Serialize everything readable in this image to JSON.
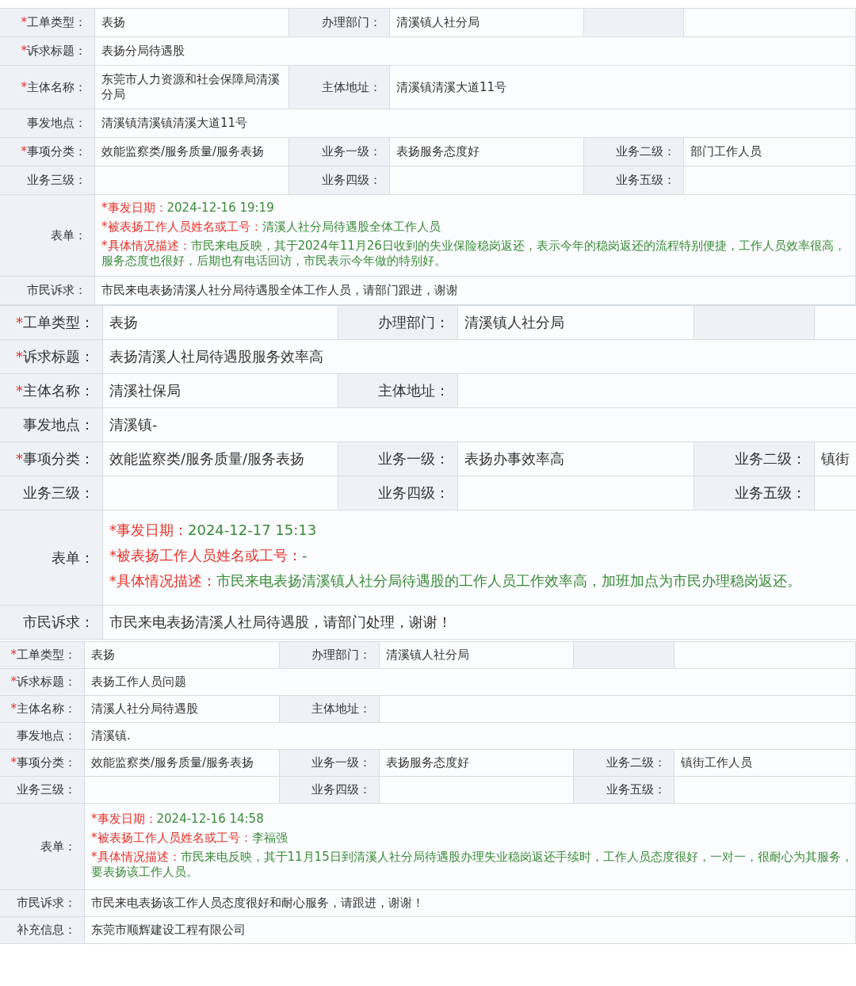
{
  "forms": [
    {
      "rows": [
        {
          "kind": "grid",
          "fields": [
            {
              "mark": "*",
              "label": "工单类型：",
              "value": "表扬"
            },
            {
              "label": "办理部门：",
              "value": "清溪镇人社分局"
            }
          ]
        },
        {
          "kind": "span",
          "fields": [
            {
              "mark": "*",
              "label": "诉求标题：",
              "value": "表扬分局待遇股"
            }
          ]
        },
        {
          "kind": "span",
          "fields": [
            {
              "mark": "*",
              "label": "主体名称：",
              "value": "东莞市人力资源和社会保障局清溪分局"
            },
            {
              "label": "主体地址：",
              "value": "清溪镇清溪大道11号"
            }
          ]
        },
        {
          "kind": "span",
          "fields": [
            {
              "label": "事发地点：",
              "value": "清溪镇清溪镇清溪大道11号"
            }
          ]
        },
        {
          "kind": "grid",
          "fields": [
            {
              "mark": "*",
              "label": "事项分类：",
              "value": "效能监察类/服务质量/服务表扬"
            },
            {
              "label": "业务一级：",
              "value": "表扬服务态度好"
            },
            {
              "label": "业务二级：",
              "value": "部门工作人员"
            }
          ]
        },
        {
          "kind": "grid",
          "fields": [
            {
              "label": "业务三级："
            },
            {
              "label": "业务四级："
            },
            {
              "label": "业务五级："
            }
          ]
        },
        {
          "kind": "details",
          "label": "表单：",
          "items": [
            {
              "mark": "*",
              "label": "事发日期：",
              "value": "2024-12-16 19:19"
            },
            {
              "mark": "*",
              "label": "被表扬工作人员姓名或工号：",
              "value": "清溪人社分局待遇股全体工作人员"
            },
            {
              "mark": "*",
              "label": "具体情况描述：",
              "value": "市民来电反映，其于2024年11月26日收到的失业保险稳岗返还，表示今年的稳岗返还的流程特别便捷，工作人员效率很高，服务态度也很好，后期也有电话回访，市民表示今年做的特别好。"
            }
          ]
        },
        {
          "kind": "span",
          "fields": [
            {
              "label": "市民诉求：",
              "value": "市民来电表扬清溪人社分局待遇股全体工作人员，请部门跟进，谢谢"
            }
          ]
        }
      ]
    },
    {
      "rows": [
        {
          "kind": "grid",
          "fields": [
            {
              "mark": "*",
              "label": "工单类型：",
              "value": "表扬"
            },
            {
              "label": "办理部门：",
              "value": "清溪镇人社分局"
            }
          ]
        },
        {
          "kind": "span",
          "fields": [
            {
              "mark": "*",
              "label": "诉求标题：",
              "value": "表扬清溪人社局待遇股服务效率高"
            }
          ]
        },
        {
          "kind": "span",
          "fields": [
            {
              "mark": "*",
              "label": "主体名称：",
              "value": "清溪社保局"
            },
            {
              "label": "主体地址："
            }
          ]
        },
        {
          "kind": "span",
          "fields": [
            {
              "label": "事发地点：",
              "value": "清溪镇-"
            }
          ]
        },
        {
          "kind": "grid",
          "fields": [
            {
              "mark": "*",
              "label": "事项分类：",
              "value": "效能监察类/服务质量/服务表扬"
            },
            {
              "label": "业务一级：",
              "value": "表扬办事效率高"
            },
            {
              "label": "业务二级：",
              "value": "镇街"
            }
          ]
        },
        {
          "kind": "grid",
          "fields": [
            {
              "label": "业务三级："
            },
            {
              "label": "业务四级："
            },
            {
              "label": "业务五级："
            }
          ]
        },
        {
          "kind": "details",
          "label": "表单：",
          "items": [
            {
              "mark": "*",
              "label": "事发日期：",
              "value": "2024-12-17 15:13"
            },
            {
              "mark": "*",
              "label": "被表扬工作人员姓名或工号：",
              "value": "-"
            },
            {
              "mark": "*",
              "label": "具体情况描述：",
              "value": "市民来电表扬清溪镇人社分局待遇股的工作人员工作效率高，加班加点为市民办理稳岗返还。"
            }
          ]
        },
        {
          "kind": "span",
          "fields": [
            {
              "label": "市民诉求：",
              "value": "市民来电表扬清溪人社局待遇股，请部门处理，谢谢！"
            }
          ]
        }
      ]
    },
    {
      "rows": [
        {
          "kind": "grid",
          "fields": [
            {
              "mark": "*",
              "label": "工单类型：",
              "value": "表扬"
            },
            {
              "label": "办理部门：",
              "value": "清溪镇人社分局"
            }
          ]
        },
        {
          "kind": "span",
          "fields": [
            {
              "mark": "*",
              "label": "诉求标题：",
              "value": "表扬工作人员问题"
            }
          ]
        },
        {
          "kind": "span",
          "fields": [
            {
              "mark": "*",
              "label": "主体名称：",
              "value": "清溪人社分局待遇股"
            },
            {
              "label": "主体地址："
            }
          ]
        },
        {
          "kind": "span",
          "fields": [
            {
              "label": "事发地点：",
              "value": "清溪镇."
            }
          ]
        },
        {
          "kind": "grid",
          "fields": [
            {
              "mark": "*",
              "label": "事项分类：",
              "value": "效能监察类/服务质量/服务表扬"
            },
            {
              "label": "业务一级：",
              "value": "表扬服务态度好"
            },
            {
              "label": "业务二级：",
              "value": "镇街工作人员"
            }
          ]
        },
        {
          "kind": "grid",
          "fields": [
            {
              "label": "业务三级："
            },
            {
              "label": "业务四级："
            },
            {
              "label": "业务五级："
            }
          ]
        },
        {
          "kind": "details",
          "label": "表单：",
          "items": [
            {
              "mark": "*",
              "label": "事发日期：",
              "value": "2024-12-16 14:58"
            },
            {
              "mark": "*",
              "label": "被表扬工作人员姓名或工号：",
              "value": "李福强"
            },
            {
              "mark": "*",
              "label": "具体情况描述：",
              "value": "市民来电反映，其于11月15日到清溪人社分局待遇股办理失业稳岗返还手续时，工作人员态度很好，一对一，很耐心为其服务，要表扬该工作人员。"
            }
          ]
        },
        {
          "kind": "span",
          "fields": [
            {
              "label": "市民诉求：",
              "value": "市民来电表扬该工作人员态度很好和耐心服务，请跟进，谢谢！"
            }
          ]
        },
        {
          "kind": "span",
          "fields": [
            {
              "label": "补充信息：",
              "value": "东莞市顺辉建设工程有限公司"
            }
          ]
        }
      ]
    }
  ]
}
